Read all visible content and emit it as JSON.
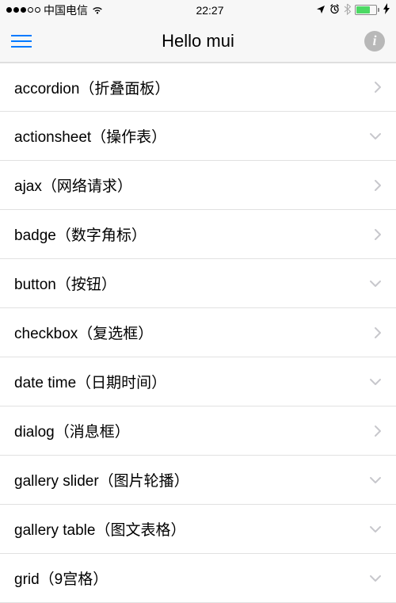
{
  "statusBar": {
    "carrier": "中国电信",
    "time": "22:27",
    "charging": true
  },
  "nav": {
    "title": "Hello mui"
  },
  "list": [
    {
      "label": "accordion（折叠面板）",
      "indicator": "right"
    },
    {
      "label": "actionsheet（操作表）",
      "indicator": "down"
    },
    {
      "label": "ajax（网络请求）",
      "indicator": "right"
    },
    {
      "label": "badge（数字角标）",
      "indicator": "right"
    },
    {
      "label": "button（按钮）",
      "indicator": "down"
    },
    {
      "label": "checkbox（复选框）",
      "indicator": "right"
    },
    {
      "label": "date time（日期时间）",
      "indicator": "down"
    },
    {
      "label": "dialog（消息框）",
      "indicator": "right"
    },
    {
      "label": "gallery slider（图片轮播）",
      "indicator": "down"
    },
    {
      "label": "gallery table（图文表格）",
      "indicator": "down"
    },
    {
      "label": "grid（9宫格）",
      "indicator": "down"
    }
  ]
}
